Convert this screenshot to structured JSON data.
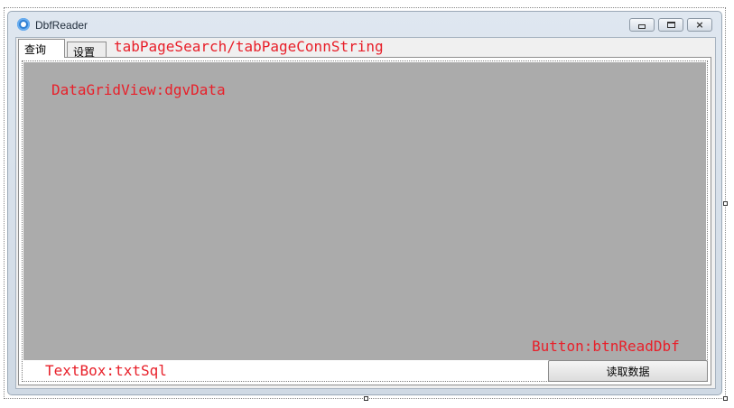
{
  "window": {
    "title": "DbfReader",
    "minimize_icon": "minimize-icon",
    "maximize_icon": "maximize-icon",
    "close_icon": "close-icon",
    "close_glyph": "×"
  },
  "tabs": [
    {
      "label": "查询",
      "active": true
    },
    {
      "label": "设置",
      "active": false
    }
  ],
  "annotations": {
    "tab_pages": "tabPageSearch/tabPageConnString",
    "grid": "DataGridView:dgvData",
    "button": "Button:btnReadDbf",
    "textbox": "TextBox:txtSql"
  },
  "sql_input": {
    "value": ""
  },
  "read_button": {
    "label": "读取数据"
  },
  "colors": {
    "annotation": "#e8202a",
    "grid_background": "#ababab"
  }
}
